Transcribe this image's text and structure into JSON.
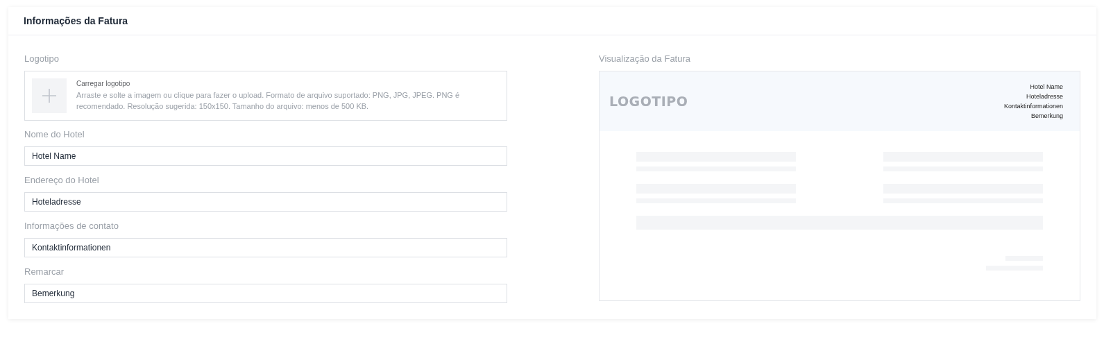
{
  "card": {
    "title": "Informações da Fatura"
  },
  "logo": {
    "label": "Logotipo",
    "upload_title": "Carregar logotipo",
    "upload_hint": "Arraste e solte a imagem ou clique para fazer o upload. Formato de arquivo suportado: PNG, JPG, JPEG. PNG é recomendado. Resolução sugerida: 150x150. Tamanho do arquivo: menos de 500 KB."
  },
  "fields": [
    {
      "label": "Nome do Hotel",
      "value": "Hotel Name"
    },
    {
      "label": "Endereço do Hotel",
      "value": "Hoteladresse"
    },
    {
      "label": "Informações de contato",
      "value": "Kontaktinformationen"
    },
    {
      "label": "Remarcar",
      "value": "Bemerkung"
    }
  ],
  "preview": {
    "label": "Visualização da Fatura",
    "logo_text": "LOGOTIPO",
    "lines": [
      "Hotel Name",
      "Hoteladresse",
      "Kontaktinformationen",
      "Bemerkung"
    ]
  }
}
